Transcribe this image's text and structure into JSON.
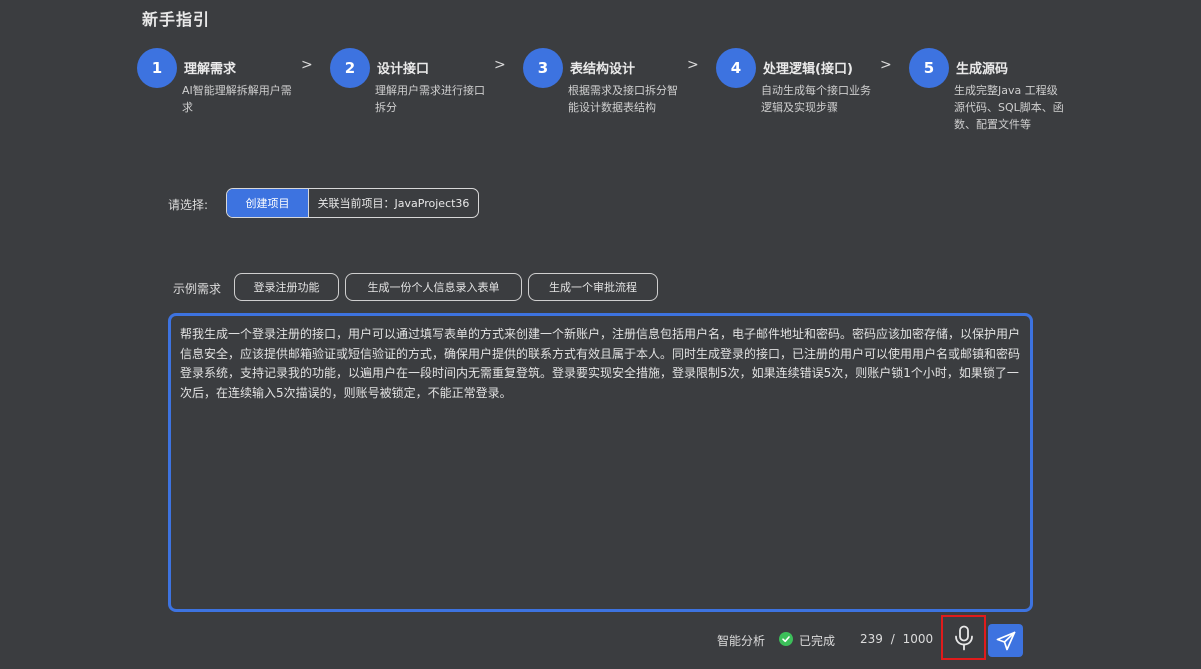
{
  "page": {
    "title": "新手指引"
  },
  "steps": [
    {
      "num": "1",
      "title": "理解需求",
      "desc": "AI智能理解拆解用户需求"
    },
    {
      "num": "2",
      "title": "设计接口",
      "desc": "理解用户需求进行接口拆分"
    },
    {
      "num": "3",
      "title": "表结构设计",
      "desc": "根据需求及接口拆分智能设计数据表结构"
    },
    {
      "num": "4",
      "title": "处理逻辑(接口)",
      "desc": "自动生成每个接口业务逻辑及实现步骤"
    },
    {
      "num": "5",
      "title": "生成源码",
      "desc": "生成完整Java 工程级源代码、SQL脚本、函数、配置文件等"
    }
  ],
  "step_arrow": ">",
  "select": {
    "label": "请选择:",
    "options": [
      "创建项目",
      "关联当前项目：JavaProject36"
    ],
    "selected": "创建项目"
  },
  "examples": {
    "label": "示例需求",
    "items": [
      "登录注册功能",
      "生成一份个人信息录入表单",
      "生成一个审批流程"
    ]
  },
  "input": {
    "value": "帮我生成一个登录注册的接口，用户可以通过填写表单的方式来创建一个新账户，注册信息包括用户名，电子邮件地址和密码。密码应该加密存储，以保护用户信息安全，应该提供邮箱验证或短信验证的方式，确保用户提供的联系方式有效且属于本人。同时生成登录的接口，已注册的用户可以使用用户名或邮镇和密码登录系统，支持记录我的功能，以遍用户在一段时间内无需重复登筑。登录要实现安全措施，登录限制5次，如果连续错误5次，则账户锁1个小时，如果锁了一次后，在连续输入5次描误的，则账号被锁定，不能正常登录。"
  },
  "footer": {
    "analysis_label": "智能分析",
    "status": "已完成",
    "count": "239",
    "separator": "/",
    "max": "1000"
  },
  "colors": {
    "accent": "#3d73e0",
    "success": "#3cbf5a",
    "highlight": "#e01b1b",
    "background": "#3b3d40"
  },
  "icons": {
    "mic": "microphone-icon",
    "send": "send-icon",
    "check": "check-circle-icon"
  }
}
